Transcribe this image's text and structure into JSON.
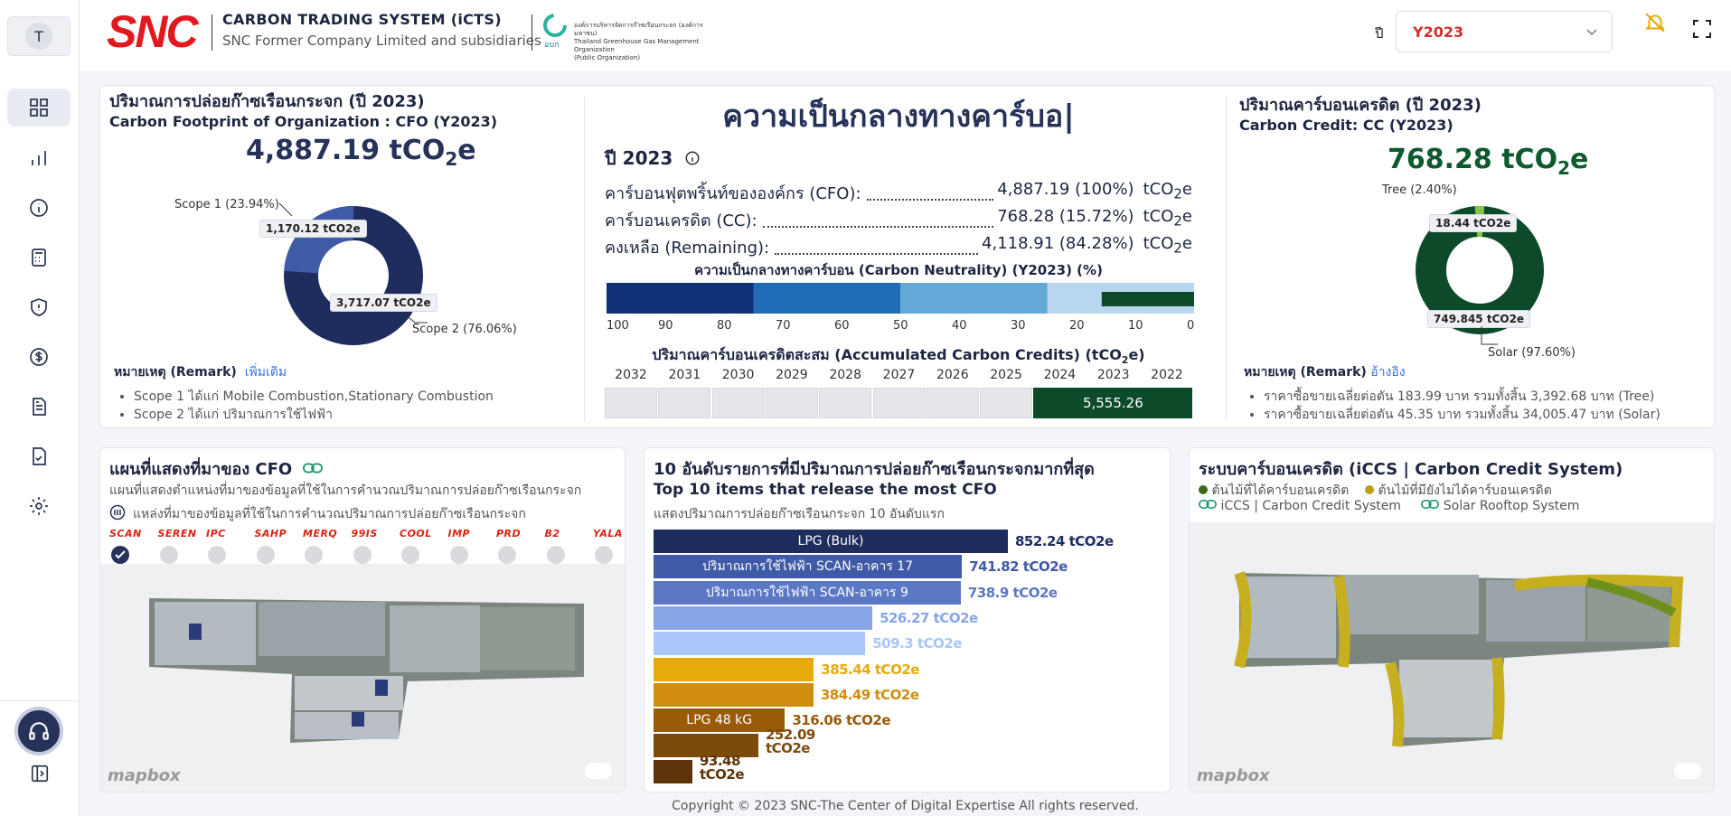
{
  "user": {
    "initial": "T"
  },
  "header": {
    "logo": "SNC",
    "title": "CARBON TRADING SYSTEM (iCTS)",
    "subtitle": "SNC Former Company Limited and subsidiaries",
    "tgo_name": "องค์การบริหารจัดการก๊าซเรือนกระจก (องค์การมหาชน)",
    "tgo_name_en": "Thailand Greenhouse Gas Management Organization",
    "tgo_public": "(Public Organization)",
    "tgo_abbr": "อบก",
    "year_label": "ปี",
    "year_value": "Y2023"
  },
  "cfo_card": {
    "title": "ปริมาณการปล่อยก๊าซเรือนกระจก (ปี 2023)",
    "subtitle": "Carbon Footprint of Organization : CFO (Y2023)",
    "total_num": "4,887.19 tCO",
    "total_sub": "2",
    "total_unit": "e",
    "scope1_label": "Scope 1 (23.94%)",
    "scope2_label": "Scope 2 (76.06%)",
    "scope1_value": "1,170.12 tCO2e",
    "scope2_value": "3,717.07 tCO2e",
    "scope1_pct": 23.94,
    "scope2_pct": 76.06,
    "remark_label": "หมายเหตุ (Remark)",
    "remark_link": "เพิ่มเติม",
    "remarks": [
      "Scope 1 ได้แก่ Mobile Combustion,Stationary Combustion",
      "Scope 2 ได้แก่ ปริมาณการใช้ไฟฟ้า"
    ],
    "colors": {
      "scope1": "#3f5aa6",
      "scope2": "#1e2c5e"
    }
  },
  "neutral_card": {
    "title": "ความเป็นกลางทางคาร์บอ|",
    "year_label": "ปี 2023",
    "lines": [
      {
        "label": "คาร์บอนฟุตพริ้นท์ขององค์กร (CFO):",
        "value": "4,887.19 (100%)",
        "unit": "tCO",
        "unit_sub": "2",
        "unit_end": "e"
      },
      {
        "label": "คาร์บอนเครดิต (CC):",
        "value": "768.28 (15.72%)",
        "unit": "tCO",
        "unit_sub": "2",
        "unit_end": "e"
      },
      {
        "label": "คงเหลือ (Remaining):",
        "value": "4,118.91 (84.28%)",
        "unit": "tCO",
        "unit_sub": "2",
        "unit_end": "e"
      }
    ],
    "bar_title": "ความเป็นกลางทางคาร์บอน (Carbon Neutrality) (Y2023) (%)",
    "bar_ticks": [
      "100",
      "90",
      "80",
      "70",
      "60",
      "50",
      "40",
      "30",
      "20",
      "10",
      "0"
    ],
    "bar_fill_pct": 15.72,
    "acc_title": "ปริมาณคาร์บอนเครดิตสะสม (Accumulated Carbon Credits) (tCO",
    "acc_title_sub": "2",
    "acc_title_end": "e)",
    "acc_years": [
      "2032",
      "2031",
      "2030",
      "2029",
      "2028",
      "2027",
      "2026",
      "2025",
      "2024",
      "2023",
      "2022"
    ],
    "acc_value": "5,555.26"
  },
  "cc_card": {
    "title": "ปริมาณคาร์บอนเครดิต (ปี 2023)",
    "subtitle": "Carbon Credit: CC (Y2023)",
    "total_num": "768.28 tCO",
    "total_sub": "2",
    "total_unit": "e",
    "tree_label": "Tree (2.40%)",
    "solar_label": "Solar (97.60%)",
    "tree_value": "18.44 tCO2e",
    "solar_value": "749.845 tCO2e",
    "tree_pct": 2.4,
    "solar_pct": 97.6,
    "remark_label": "หมายเหตุ (Remark)",
    "remark_link": "อ้างอิง",
    "remarks": [
      "ราคาซื้อขายเฉลี่ยต่อตัน 183.99 บาท รวมทั้งสิ้น 3,392.68 บาท (Tree)",
      "ราคาซื้อขายเฉลี่ยต่อตัน 45.35 บาท รวมทั้งสิ้น 34,005.47 บาท (Solar)"
    ],
    "colors": {
      "tree": "#8bc34a",
      "solar": "#0c4a2a"
    }
  },
  "map_card": {
    "title": "แผนที่แสดงที่มาของ CFO",
    "desc": "แผนที่แสดงตำแหน่งที่มาของข้อมูลที่ใช้ในการคำนวณปริมาณการปล่อยก๊าซเรือนกระจก",
    "legend": "แหล่งที่มาของข้อมูลที่ใช้ในการคำนวณปริมาณการปล่อยก๊าซเรือนกระจก",
    "sites": [
      "SCAN",
      "SEREN",
      "IPC",
      "SAHP",
      "MERQ",
      "99IS",
      "COOL",
      "IMP",
      "PRD",
      "B2",
      "YALA"
    ],
    "mapbox": "mapbox"
  },
  "top10_card": {
    "title": "10 อันดับรายการที่มีปริมาณการปล่อยก๊าซเรือนกระจกมากที่สุด",
    "subtitle": "Top 10 items that release the most CFO",
    "desc": "แสดงปริมาณการปล่อยก๊าซเรือนกระจก 10 อันดับแรก",
    "items": [
      {
        "label": "LPG (Bulk)",
        "value": 852.24,
        "text": "852.24 tCO2e",
        "color": "#1e2c5e"
      },
      {
        "label": "ปริมาณการใช้ไฟฟ้า SCAN-อาคาร 17",
        "value": 741.82,
        "text": "741.82 tCO2e",
        "color": "#3f5aa6"
      },
      {
        "label": "ปริมาณการใช้ไฟฟ้า SCAN-อาคาร 9",
        "value": 738.9,
        "text": "738.9 tCO2e",
        "color": "#5b78c4"
      },
      {
        "label": "",
        "value": 526.27,
        "text": "526.27 tCO2e",
        "color": "#87a6e8"
      },
      {
        "label": "",
        "value": 509.3,
        "text": "509.3 tCO2e",
        "color": "#a9c6fa"
      },
      {
        "label": "",
        "value": 385.44,
        "text": "385.44 tCO2e",
        "color": "#e6ab0b"
      },
      {
        "label": "",
        "value": 384.49,
        "text": "384.49 tCO2e",
        "color": "#d18d0d"
      },
      {
        "label": "LPG 48 kG",
        "value": 316.06,
        "text": "316.06 tCO2e",
        "color": "#9b5a08"
      },
      {
        "label": "",
        "value": 252.09,
        "text": "252.09",
        "text2": "tCO2e",
        "color": "#7c4a0b"
      },
      {
        "label": "",
        "value": 93.48,
        "text": "93.48",
        "text2": "tCO2e",
        "color": "#5d3409"
      }
    ]
  },
  "ccs_card": {
    "title": "ระบบคาร์บอนเครดิต (iCCS | Carbon Credit System)",
    "legend_tree_cc": "ต้นไม้ที่ได้คาร์บอนเครดิต",
    "legend_tree_no": "ต้นไม้ที่มียังไม่ได้คาร์บอนเครดิต",
    "legend_iccs": "iCCS | Carbon Credit System",
    "legend_solar": "Solar Rooftop System",
    "mapbox": "mapbox"
  },
  "footer": "Copyright © 2023 SNC-The Center of Digital Expertise   All rights reserved."
}
